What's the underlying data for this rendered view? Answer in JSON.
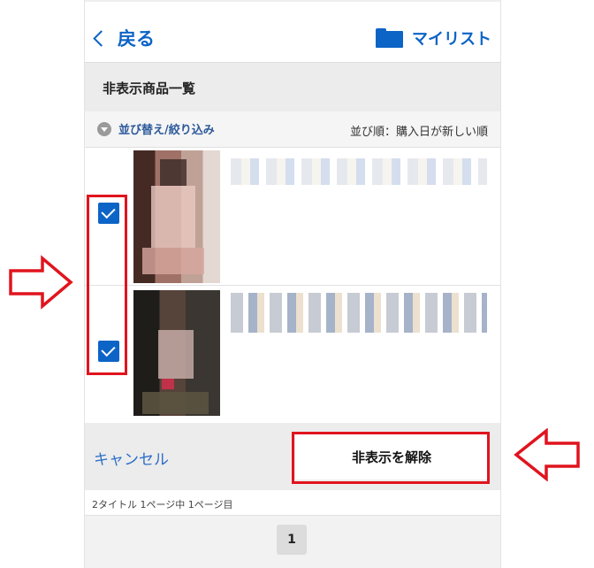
{
  "header": {
    "back_label": "戻る",
    "mylist_label": "マイリスト"
  },
  "section": {
    "title": "非表示商品一覧"
  },
  "sort": {
    "toggle_label": "並び替え/絞り込み",
    "order_label": "並び順：購入日が新しい順"
  },
  "items": [
    {
      "checked": true
    },
    {
      "checked": true
    }
  ],
  "actions": {
    "cancel_label": "キャンセル",
    "unhide_label": "非表示を解除"
  },
  "pagination": {
    "summary": "2タイトル 1ページ中 1ページ目",
    "current_page": "1"
  },
  "colors": {
    "accent": "#0c64c6",
    "annotation": "#e0141e"
  }
}
